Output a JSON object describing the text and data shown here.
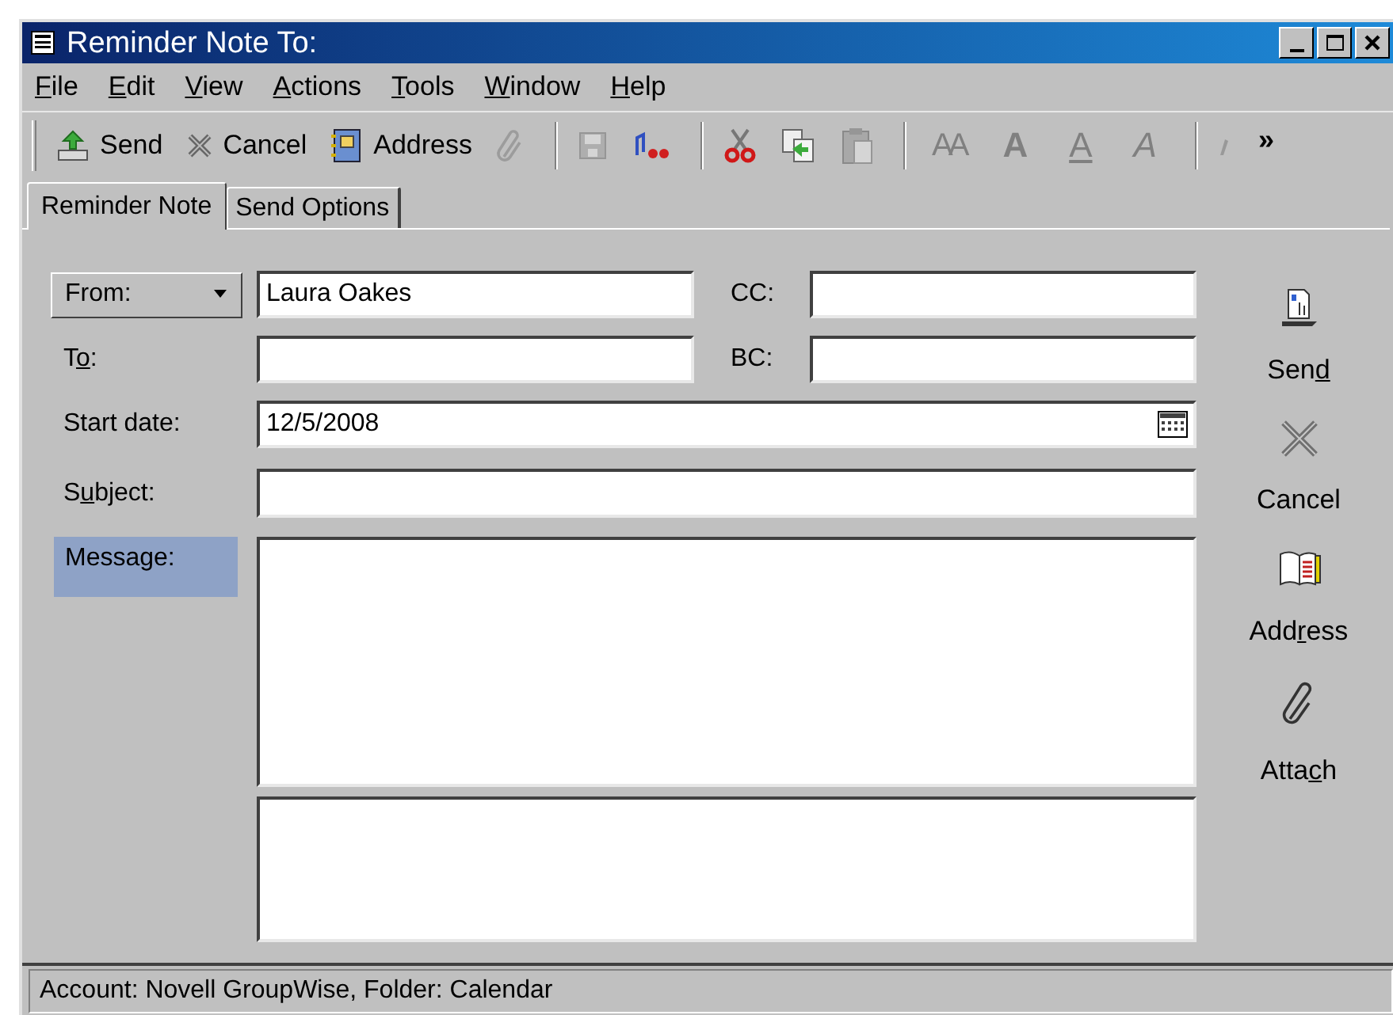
{
  "window": {
    "title": "Reminder Note To:"
  },
  "menu": [
    {
      "label": {
        "key": "F",
        "post": "ile"
      }
    },
    {
      "label": {
        "key": "E",
        "post": "dit"
      }
    },
    {
      "label": {
        "key": "V",
        "post": "iew"
      }
    },
    {
      "label": {
        "key": "A",
        "post": "ctions"
      }
    },
    {
      "label": {
        "key": "T",
        "post": "ools"
      }
    },
    {
      "label": {
        "key": "W",
        "post": "indow"
      }
    },
    {
      "label": {
        "key": "H",
        "post": "elp"
      }
    }
  ],
  "toolbar": [
    {
      "kind": "send",
      "label": "Send",
      "disabled": false
    },
    {
      "kind": "cancel",
      "label": "Cancel",
      "disabled": false
    },
    {
      "kind": "address",
      "label": "Address",
      "disabled": false
    },
    {
      "kind": "attach",
      "disabled": true
    },
    {
      "kind": "sep"
    },
    {
      "kind": "save",
      "disabled": true
    },
    {
      "kind": "spell",
      "disabled": false
    },
    {
      "kind": "sep"
    },
    {
      "kind": "cut",
      "disabled": false
    },
    {
      "kind": "copy",
      "disabled": false
    },
    {
      "kind": "paste",
      "disabled": true
    },
    {
      "kind": "sep"
    },
    {
      "kind": "font",
      "label": "AA",
      "disabled": true
    },
    {
      "kind": "bold",
      "label": "A",
      "disabled": true
    },
    {
      "kind": "underline",
      "label": "A",
      "disabled": true
    },
    {
      "kind": "italic",
      "label": "A",
      "disabled": true
    },
    {
      "kind": "sep"
    },
    {
      "kind": "partial"
    },
    {
      "kind": "more",
      "label": "»",
      "disabled": false
    }
  ],
  "tabs": [
    {
      "label": "Reminder Note",
      "selected": true
    },
    {
      "label": "Send Options",
      "selected": false
    }
  ],
  "form": {
    "from": {
      "label": "From:",
      "value": "Laura Oakes"
    },
    "cc": {
      "label": "CC:"
    },
    "to": {
      "label": {
        "pre": "T",
        "key": "o",
        "post": ":"
      }
    },
    "bc": {
      "label": "BC:"
    },
    "start_date": {
      "label": "Start date:",
      "value": "12/5/2008"
    },
    "subject": {
      "label": {
        "pre": "S",
        "key": "u",
        "post": "bject:"
      }
    },
    "message": {
      "label": "Message:",
      "selected": true
    }
  },
  "actions": [
    {
      "kind": "send",
      "label": {
        "pre": "Sen",
        "key": "d"
      }
    },
    {
      "kind": "cancel",
      "label": "Cancel"
    },
    {
      "kind": "address",
      "label": {
        "pre": "Add",
        "key": "r",
        "post": "ess"
      }
    },
    {
      "kind": "attach",
      "label": {
        "pre": "Atta",
        "key": "c",
        "post": "h"
      }
    }
  ],
  "status_bar": "Account: Novell GroupWise,  Folder: Calendar"
}
